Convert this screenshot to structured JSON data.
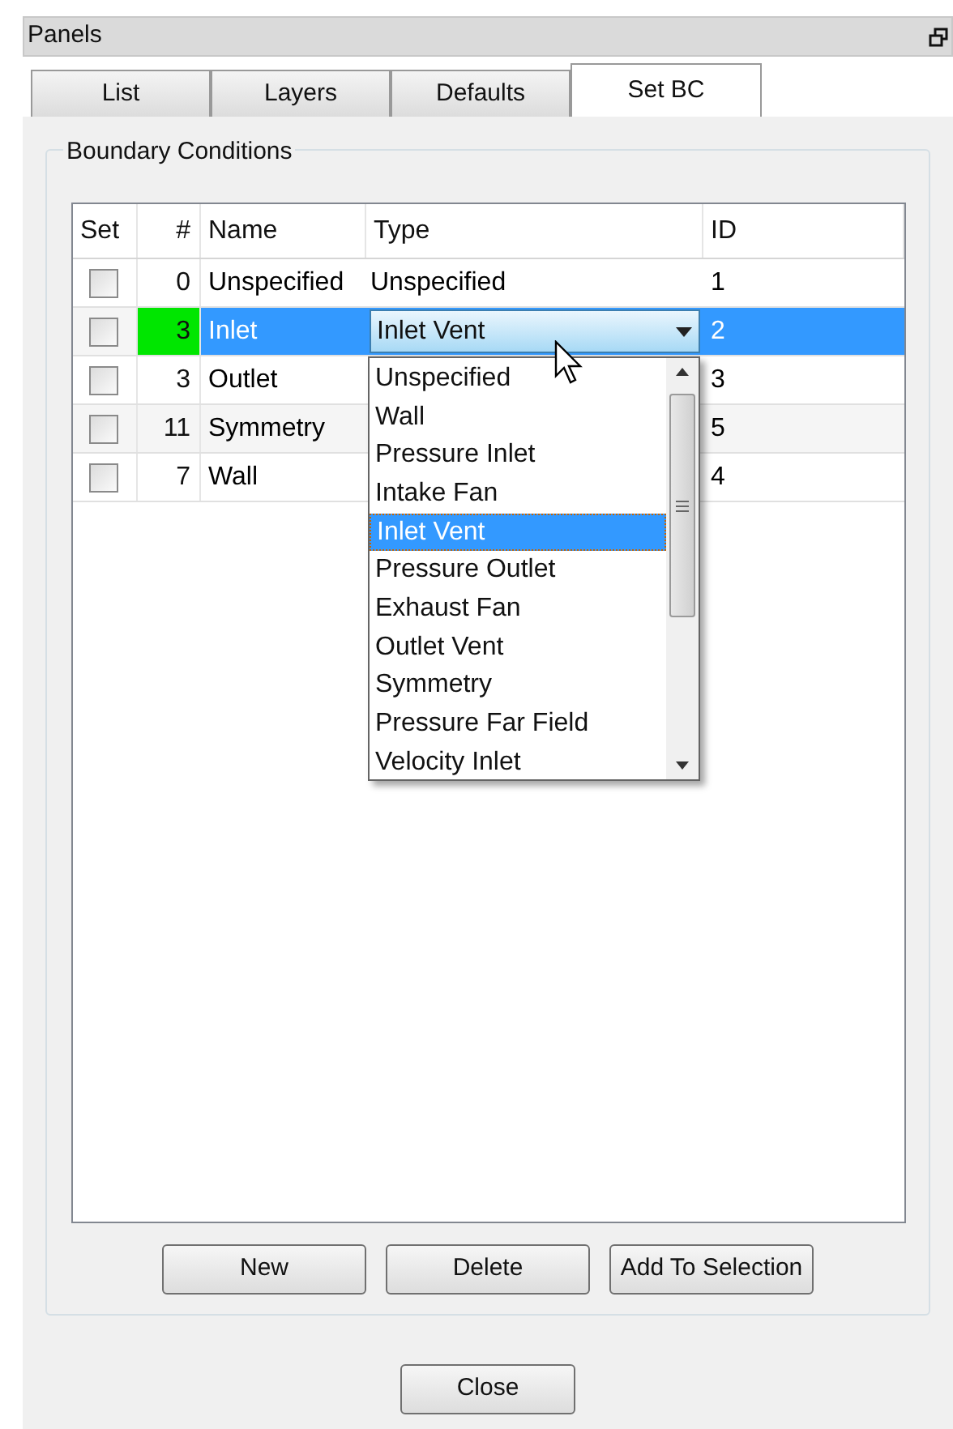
{
  "panel": {
    "title": "Panels"
  },
  "tabs": [
    {
      "label": "List",
      "selected": false
    },
    {
      "label": "Layers",
      "selected": false
    },
    {
      "label": "Defaults",
      "selected": false
    },
    {
      "label": "Set BC",
      "selected": true
    }
  ],
  "group": {
    "title": "Boundary Conditions"
  },
  "table": {
    "columns": [
      "Set",
      "#",
      "Name",
      "Type",
      "ID"
    ],
    "rows": [
      {
        "checked": false,
        "number": "0",
        "number_highlighted": false,
        "name": "Unspecified",
        "type": "Unspecified",
        "id": "1",
        "selected": false,
        "dropdown_open": false
      },
      {
        "checked": false,
        "number": "3",
        "number_highlighted": true,
        "name": "Inlet",
        "type": "Inlet Vent",
        "id": "2",
        "selected": true,
        "dropdown_open": true
      },
      {
        "checked": false,
        "number": "3",
        "number_highlighted": false,
        "name": "Outlet",
        "id": "3",
        "selected": false,
        "dropdown_open": false
      },
      {
        "checked": false,
        "number": "11",
        "number_highlighted": false,
        "name": "Symmetry",
        "id": "5",
        "selected": false,
        "dropdown_open": false
      },
      {
        "checked": false,
        "number": "7",
        "number_highlighted": false,
        "name": "Wall",
        "id": "4",
        "selected": false,
        "dropdown_open": false
      }
    ]
  },
  "dropdown": {
    "options": [
      {
        "label": "Unspecified",
        "selected": false
      },
      {
        "label": "Wall",
        "selected": false
      },
      {
        "label": "Pressure Inlet",
        "selected": false
      },
      {
        "label": "Intake Fan",
        "selected": false
      },
      {
        "label": "Inlet Vent",
        "selected": true
      },
      {
        "label": "Pressure Outlet",
        "selected": false
      },
      {
        "label": "Exhaust Fan",
        "selected": false
      },
      {
        "label": "Outlet Vent",
        "selected": false
      },
      {
        "label": "Symmetry",
        "selected": false
      },
      {
        "label": "Pressure Far Field",
        "selected": false
      },
      {
        "label": "Velocity Inlet",
        "selected": false
      }
    ]
  },
  "buttons": [
    "New",
    "Delete",
    "Add To Selection"
  ],
  "footer_button": "Close"
}
